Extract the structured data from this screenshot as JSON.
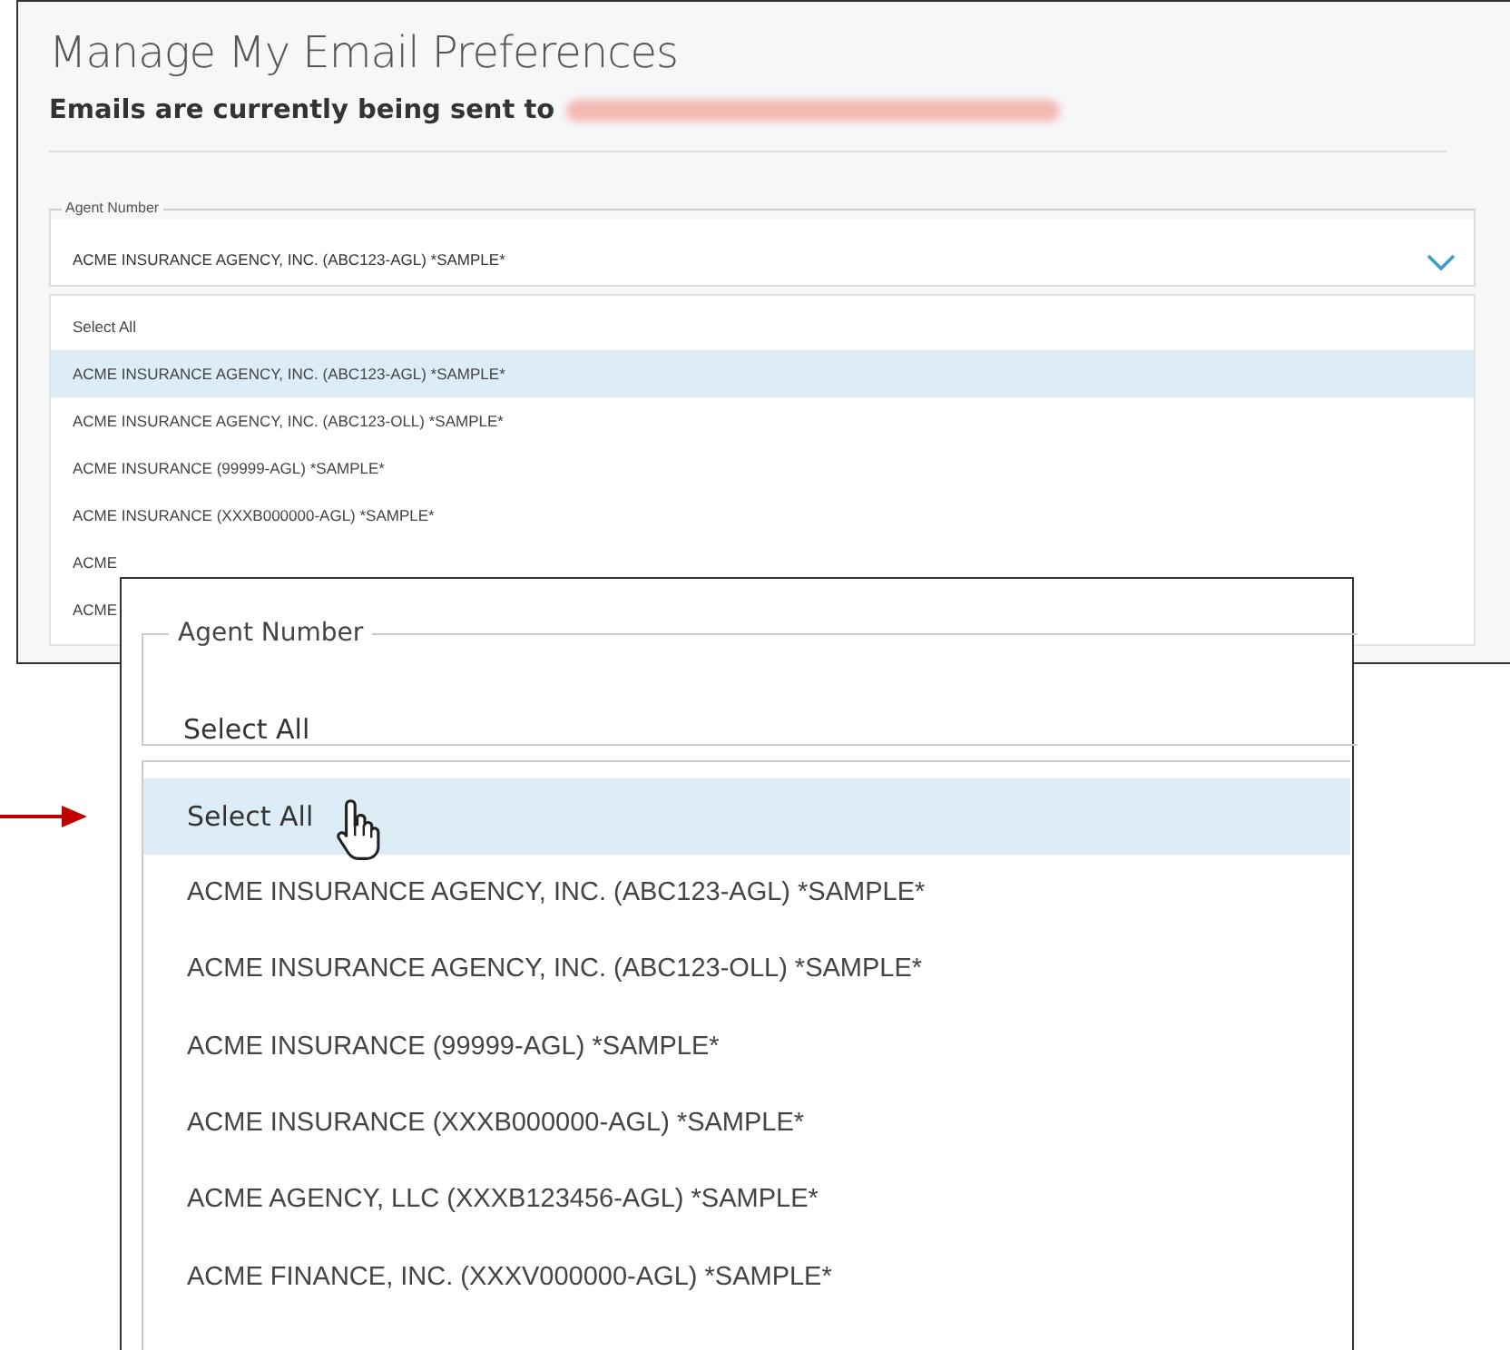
{
  "back_panel": {
    "title": "Manage My Email Preferences",
    "subtitle": "Emails are currently being sent to",
    "field": {
      "label": "Agent Number",
      "value": "ACME INSURANCE AGENCY, INC. (ABC123-AGL) *SAMPLE*"
    },
    "options": [
      {
        "label": "Select All",
        "selected": false
      },
      {
        "label": "ACME INSURANCE AGENCY, INC. (ABC123-AGL) *SAMPLE*",
        "selected": true
      },
      {
        "label": "ACME INSURANCE AGENCY, INC. (ABC123-OLL) *SAMPLE*",
        "selected": false
      },
      {
        "label": "ACME INSURANCE (99999-AGL) *SAMPLE*",
        "selected": false
      },
      {
        "label": "ACME INSURANCE (XXXB000000-AGL) *SAMPLE*",
        "selected": false
      },
      {
        "label": "ACME",
        "selected": false
      },
      {
        "label": "ACME",
        "selected": false
      }
    ]
  },
  "front_panel": {
    "field": {
      "label": "Agent Number",
      "value": "Select All"
    },
    "options": [
      {
        "label": "Select All",
        "selected": true
      },
      {
        "label": "ACME INSURANCE AGENCY, INC. (ABC123-AGL) *SAMPLE*",
        "selected": false
      },
      {
        "label": "ACME INSURANCE AGENCY, INC. (ABC123-OLL) *SAMPLE*",
        "selected": false
      },
      {
        "label": "ACME INSURANCE (99999-AGL) *SAMPLE*",
        "selected": false
      },
      {
        "label": "ACME INSURANCE (XXXB000000-AGL) *SAMPLE*",
        "selected": false
      },
      {
        "label": "ACME AGENCY, LLC (XXXB123456-AGL) *SAMPLE*",
        "selected": false
      },
      {
        "label": "ACME FINANCE, INC. (XXXV000000-AGL) *SAMPLE*",
        "selected": false
      }
    ]
  }
}
